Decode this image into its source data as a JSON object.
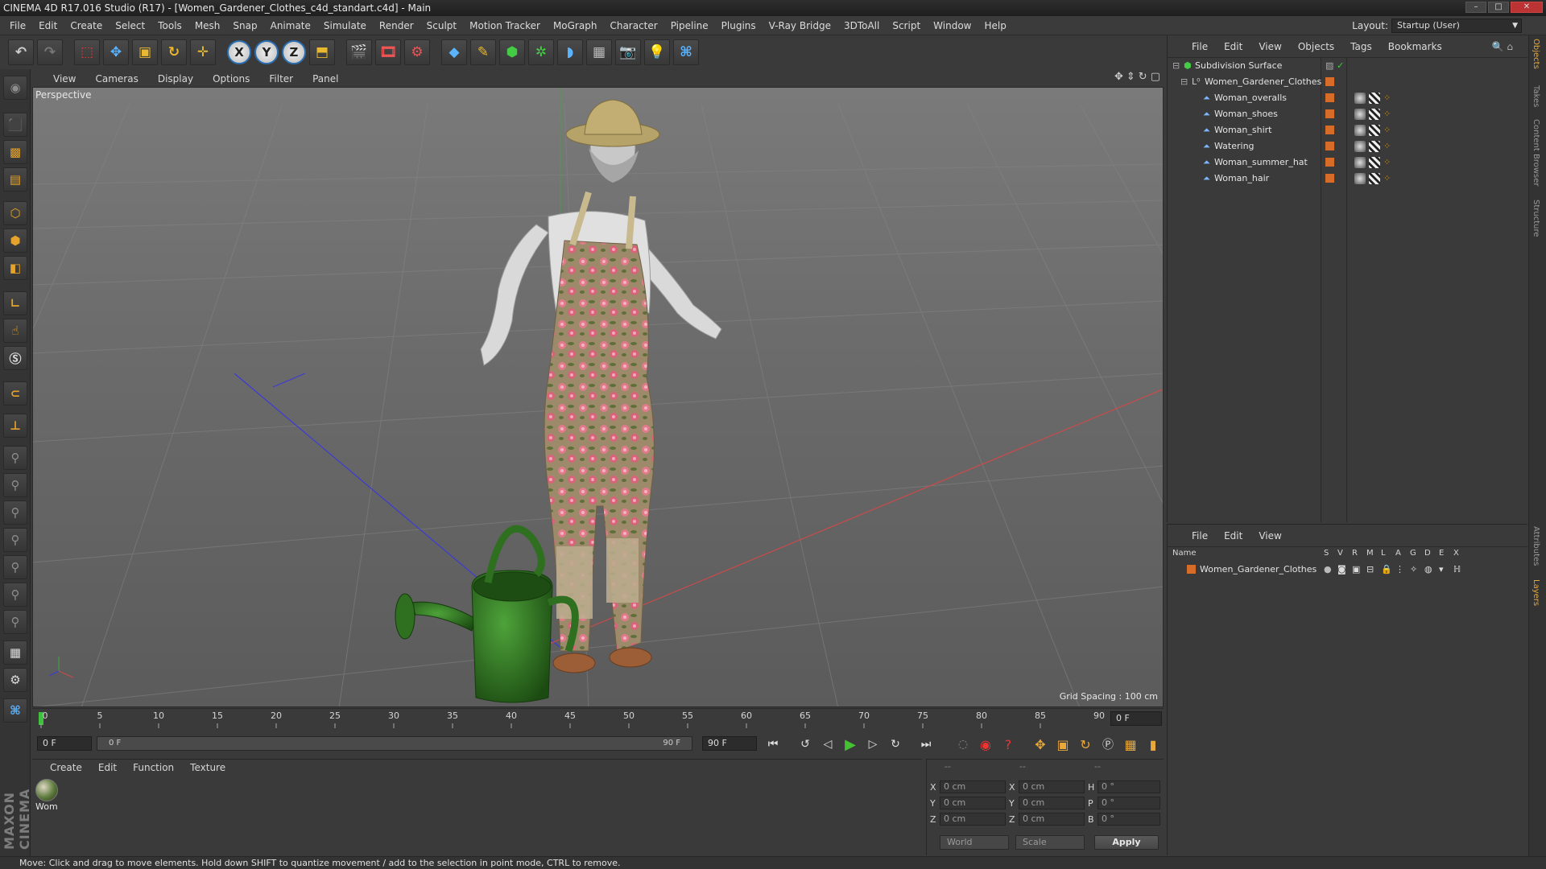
{
  "window": {
    "title": "CINEMA 4D R17.016 Studio (R17) - [Women_Gardener_Clothes_c4d_standart.c4d] - Main"
  },
  "menubar": {
    "items": [
      "File",
      "Edit",
      "Create",
      "Select",
      "Tools",
      "Mesh",
      "Snap",
      "Animate",
      "Simulate",
      "Render",
      "Sculpt",
      "Motion Tracker",
      "MoGraph",
      "Character",
      "Pipeline",
      "Plugins",
      "V-Ray Bridge",
      "3DToAll",
      "Script",
      "Window",
      "Help"
    ],
    "layout_label": "Layout:",
    "layout_value": "Startup (User)"
  },
  "toolbar": {
    "axis_x": "X",
    "axis_y": "Y",
    "axis_z": "Z"
  },
  "viewport": {
    "menu": [
      "View",
      "Cameras",
      "Display",
      "Options",
      "Filter",
      "Panel"
    ],
    "label": "Perspective",
    "grid_spacing": "Grid Spacing : 100 cm"
  },
  "timeline": {
    "ticks": [
      "0",
      "5",
      "10",
      "15",
      "20",
      "25",
      "30",
      "35",
      "40",
      "45",
      "50",
      "55",
      "60",
      "65",
      "70",
      "75",
      "80",
      "85",
      "90"
    ],
    "current_frame": "0 F"
  },
  "transport": {
    "start_field": "0 F",
    "slider_start": "0 F",
    "slider_end": "90 F",
    "end_field": "90 F"
  },
  "materials": {
    "menu": [
      "Create",
      "Edit",
      "Function",
      "Texture"
    ],
    "items": [
      {
        "name": "Wom"
      }
    ]
  },
  "coordinates": {
    "header": [
      "--",
      "--",
      "--"
    ],
    "rows": [
      {
        "a_label": "X",
        "a": "0 cm",
        "b_label": "X",
        "b": "0 cm",
        "c_label": "H",
        "c": "0 °"
      },
      {
        "a_label": "Y",
        "a": "0 cm",
        "b_label": "Y",
        "b": "0 cm",
        "c_label": "P",
        "c": "0 °"
      },
      {
        "a_label": "Z",
        "a": "0 cm",
        "b_label": "Z",
        "b": "0 cm",
        "c_label": "B",
        "c": "0 °"
      }
    ],
    "mode": "World",
    "size_mode": "Scale",
    "apply": "Apply"
  },
  "object_manager": {
    "menu": [
      "File",
      "Edit",
      "View",
      "Objects",
      "Tags",
      "Bookmarks"
    ],
    "objects": [
      {
        "name": "Subdivision Surface",
        "level": 0
      },
      {
        "name": "Women_Gardener_Clothes",
        "level": 1
      },
      {
        "name": "Woman_overalls",
        "level": 2
      },
      {
        "name": "Woman_shoes",
        "level": 2
      },
      {
        "name": "Woman_shirt",
        "level": 2
      },
      {
        "name": "Watering",
        "level": 2
      },
      {
        "name": "Woman_summer_hat",
        "level": 2
      },
      {
        "name": "Woman_hair",
        "level": 2
      }
    ]
  },
  "layer_manager": {
    "menu": [
      "File",
      "Edit",
      "View"
    ],
    "columns": [
      "Name",
      "S",
      "V",
      "R",
      "M",
      "L",
      "A",
      "G",
      "D",
      "E",
      "X"
    ],
    "layers": [
      {
        "name": "Women_Gardener_Clothes"
      }
    ]
  },
  "right_tabs": [
    "Objects",
    "Takes",
    "Content Browser",
    "Structure",
    "Attributes",
    "Layers"
  ],
  "status": {
    "text": "Move: Click and drag to move elements. Hold down SHIFT to quantize movement / add to the selection in point mode, CTRL to remove."
  },
  "colors": {
    "accent": "#e8a83a",
    "layer_color": "#d76c28",
    "play_green": "#44c233"
  }
}
